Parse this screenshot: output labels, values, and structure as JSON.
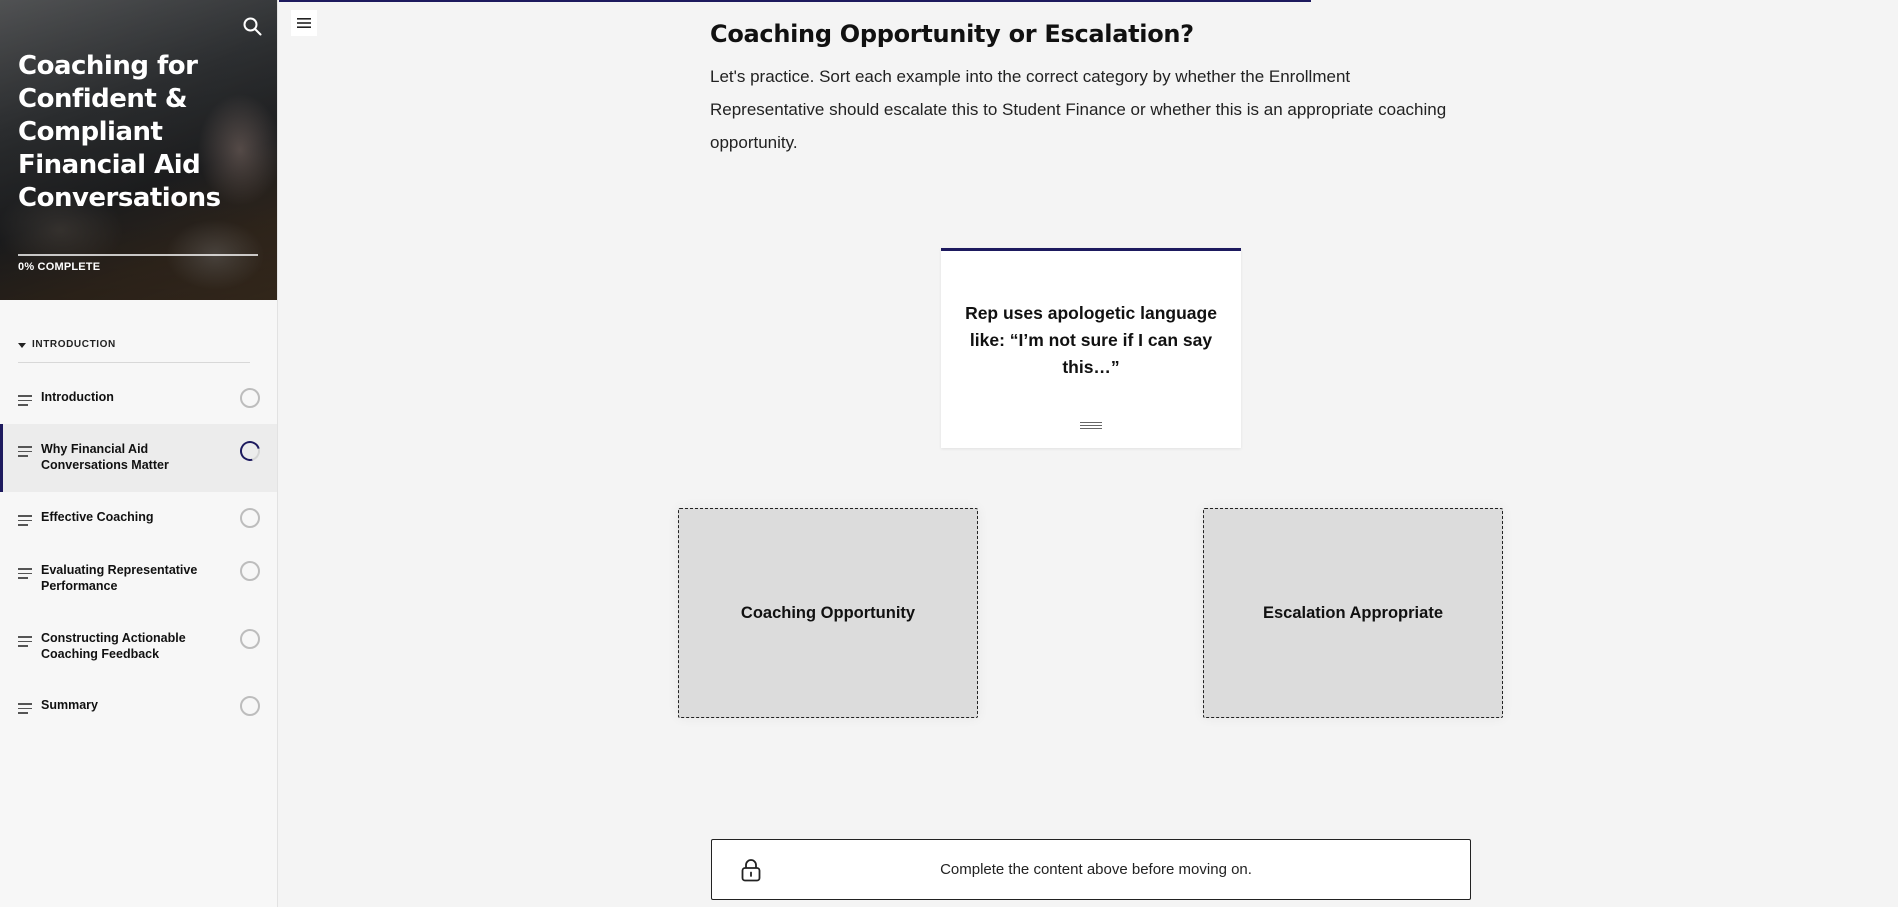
{
  "sidebar": {
    "course_title": "Coaching for Confident & Compliant Financial Aid Conversations",
    "progress_label": "0% COMPLETE",
    "section": {
      "label": "INTRODUCTION"
    },
    "items": [
      {
        "label": "Introduction",
        "status": "not-started"
      },
      {
        "label": "Why Financial Aid Conversations Matter",
        "status": "in-progress"
      },
      {
        "label": "Effective Coaching",
        "status": "not-started"
      },
      {
        "label": "Evaluating Representative Performance",
        "status": "not-started"
      },
      {
        "label": "Constructing Actionable Coaching Feedback",
        "status": "not-started"
      },
      {
        "label": "Summary",
        "status": "not-started"
      }
    ]
  },
  "main": {
    "title": "Coaching Opportunity or Escalation?",
    "intro": "Let's practice. Sort each example into the correct category by whether the Enrollment Representative should escalate this to Student Finance or whether this is an appropriate coaching opportunity.",
    "card": {
      "text": "Rep uses apologetic language like: “I’m not sure if I can say this…”"
    },
    "zones": [
      {
        "label": "Coaching Opportunity"
      },
      {
        "label": "Escalation Appropriate"
      }
    ],
    "lock_message": "Complete the content above before moving on."
  },
  "colors": {
    "accent": "#1d1a5e",
    "zone_bg": "#dcdcdc",
    "page_bg": "#f4f4f4"
  },
  "icons": {
    "search": "search-icon",
    "menu": "menu-icon",
    "lock": "lock-icon",
    "drag": "drag-handle-icon",
    "item": "lesson-lines-icon"
  }
}
